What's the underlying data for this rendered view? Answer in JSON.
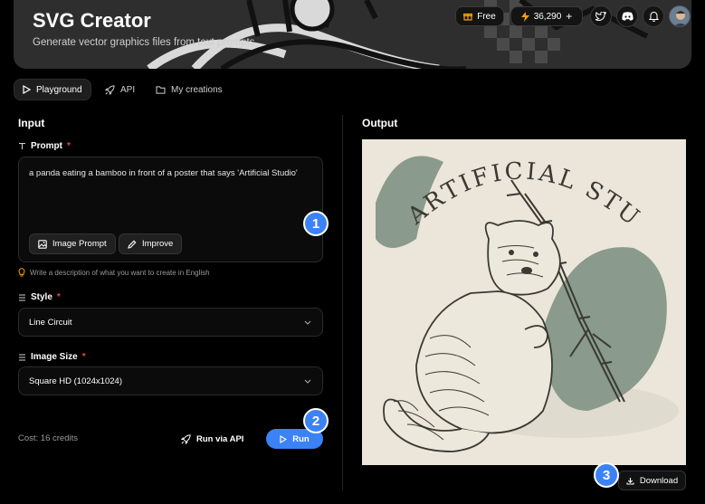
{
  "header": {
    "title": "SVG Creator",
    "subtitle": "Generate vector graphics files from text prompts.",
    "plan_label": "Free",
    "credits_label": "36,290",
    "credits_plus": "+",
    "icons": [
      "gift-icon",
      "bolt-icon",
      "twitter-icon",
      "discord-icon",
      "bell-icon",
      "avatar"
    ]
  },
  "tabs": [
    {
      "label": "Playground",
      "icon": "play-icon",
      "active": true
    },
    {
      "label": "API",
      "icon": "rocket-icon",
      "active": false
    },
    {
      "label": "My creations",
      "icon": "folder-icon",
      "active": false
    }
  ],
  "input": {
    "section_title": "Input",
    "prompt_label": "Prompt",
    "prompt_required": "*",
    "prompt_value": "a panda eating a bamboo in front of a poster that says 'Artificial Studio'",
    "image_prompt_label": "Image Prompt",
    "improve_label": "Improve",
    "hint": "Write a description of what you want to create in English",
    "style_label": "Style",
    "style_required": "*",
    "style_value": "Line Circuit",
    "size_label": "Image Size",
    "size_required": "*",
    "size_value": "Square HD (1024x1024)",
    "cost": "Cost: 16 credits",
    "run_api_label": "Run via API",
    "run_label": "Run"
  },
  "output": {
    "section_title": "Output",
    "poster_text": "ARTIFICIAL STUDIO",
    "download_label": "Download"
  },
  "markers": [
    "1",
    "2",
    "3"
  ],
  "colors": {
    "accent": "#3b82f6",
    "required": "#ef4444",
    "background": "#000000",
    "poster_bg": "#ece6da",
    "poster_green": "#8a9a8c"
  }
}
